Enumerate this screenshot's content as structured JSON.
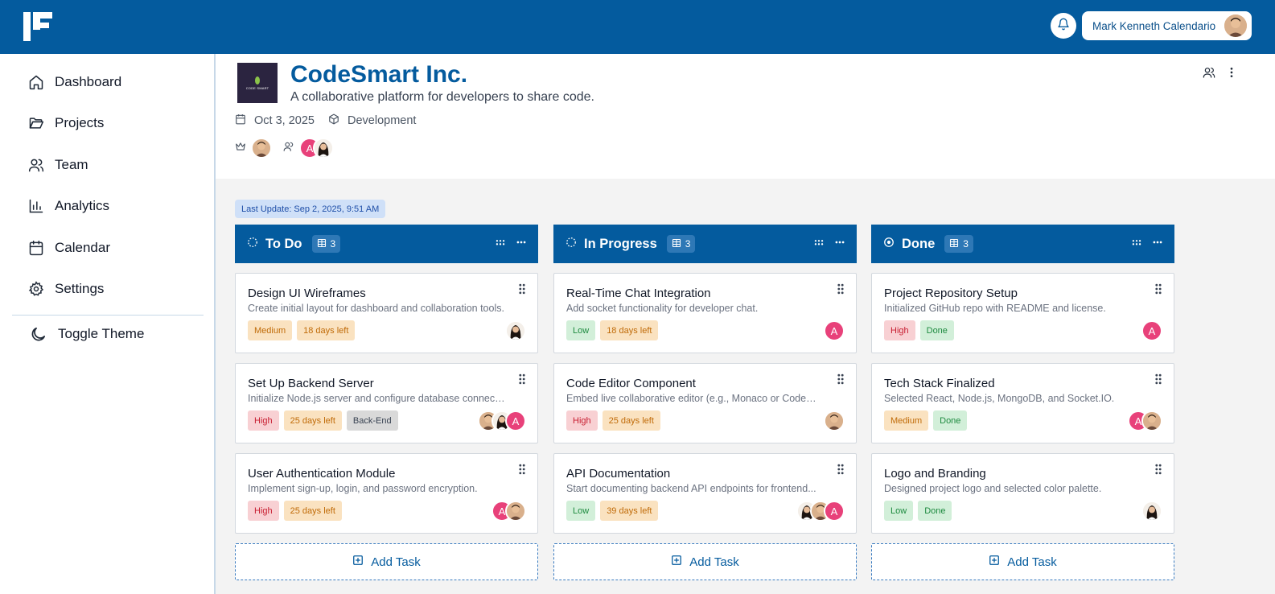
{
  "header": {
    "user_name": "Mark Kenneth Calendario"
  },
  "sidebar": {
    "items": [
      {
        "label": "Dashboard",
        "icon": "home-icon"
      },
      {
        "label": "Projects",
        "icon": "folder-icon"
      },
      {
        "label": "Team",
        "icon": "users-icon"
      },
      {
        "label": "Analytics",
        "icon": "bar-chart-icon"
      },
      {
        "label": "Calendar",
        "icon": "calendar-icon"
      },
      {
        "label": "Settings",
        "icon": "gear-icon"
      }
    ],
    "toggle_theme": "Toggle Theme"
  },
  "project": {
    "logo_text": "CODE SMART",
    "title": "CodeSmart Inc.",
    "description": "A collaborative platform for developers to share code.",
    "date": "Oct 3, 2025",
    "category": "Development",
    "members_avatar_letter": "A"
  },
  "last_update": "Last Update: Sep 2, 2025, 9:51 AM",
  "columns": [
    {
      "title": "To Do",
      "count": "3",
      "icon": "dashed-circle-icon",
      "cards": [
        {
          "title": "Design UI Wireframes",
          "desc": "Create initial layout for dashboard and collaboration tools.",
          "tags": [
            {
              "text": "Medium",
              "kind": "medium"
            },
            {
              "text": "18 days left",
              "kind": "days"
            }
          ],
          "avatars": [
            "woman"
          ]
        },
        {
          "title": "Set Up Backend Server",
          "desc": "Initialize Node.js server and configure database connection.",
          "tags": [
            {
              "text": "High",
              "kind": "high"
            },
            {
              "text": "25 days left",
              "kind": "days"
            },
            {
              "text": "Back-End",
              "kind": "grey"
            }
          ],
          "avatars": [
            "man",
            "woman",
            "A"
          ]
        },
        {
          "title": "User Authentication Module",
          "desc": "Implement sign-up, login, and password encryption.",
          "tags": [
            {
              "text": "High",
              "kind": "high"
            },
            {
              "text": "25 days left",
              "kind": "days"
            }
          ],
          "avatars": [
            "A",
            "man"
          ]
        }
      ],
      "add_label": "Add Task"
    },
    {
      "title": "In Progress",
      "count": "3",
      "icon": "dashed-circle-icon",
      "cards": [
        {
          "title": "Real-Time Chat Integration",
          "desc": "Add socket functionality for developer chat.",
          "tags": [
            {
              "text": "Low",
              "kind": "low"
            },
            {
              "text": "18 days left",
              "kind": "days"
            }
          ],
          "avatars": [
            "A"
          ]
        },
        {
          "title": "Code Editor Component",
          "desc": "Embed live collaborative editor (e.g., Monaco or CodeMirror).",
          "tags": [
            {
              "text": "High",
              "kind": "high"
            },
            {
              "text": "25 days left",
              "kind": "days"
            }
          ],
          "avatars": [
            "man"
          ]
        },
        {
          "title": "API Documentation",
          "desc": "Start documenting backend API endpoints for frontend...",
          "tags": [
            {
              "text": "Low",
              "kind": "low"
            },
            {
              "text": "39 days left",
              "kind": "days"
            }
          ],
          "avatars": [
            "woman",
            "man",
            "A"
          ]
        }
      ],
      "add_label": "Add Task"
    },
    {
      "title": "Done",
      "count": "3",
      "icon": "check-circle-icon",
      "cards": [
        {
          "title": "Project Repository Setup",
          "desc": "Initialized GitHub repo with README and license.",
          "tags": [
            {
              "text": "High",
              "kind": "high"
            },
            {
              "text": "Done",
              "kind": "done"
            }
          ],
          "avatars": [
            "A"
          ]
        },
        {
          "title": "Tech Stack Finalized",
          "desc": "Selected React, Node.js, MongoDB, and Socket.IO.",
          "tags": [
            {
              "text": "Medium",
              "kind": "medium"
            },
            {
              "text": "Done",
              "kind": "done"
            }
          ],
          "avatars": [
            "A",
            "man"
          ]
        },
        {
          "title": "Logo and Branding",
          "desc": "Designed project logo and selected color palette.",
          "tags": [
            {
              "text": "Low",
              "kind": "low"
            },
            {
              "text": "Done",
              "kind": "done"
            }
          ],
          "avatars": [
            "woman"
          ]
        }
      ],
      "add_label": "Add Task"
    }
  ],
  "colors": {
    "brand": "#045b9e",
    "avatar_pink": "#e8417a"
  }
}
